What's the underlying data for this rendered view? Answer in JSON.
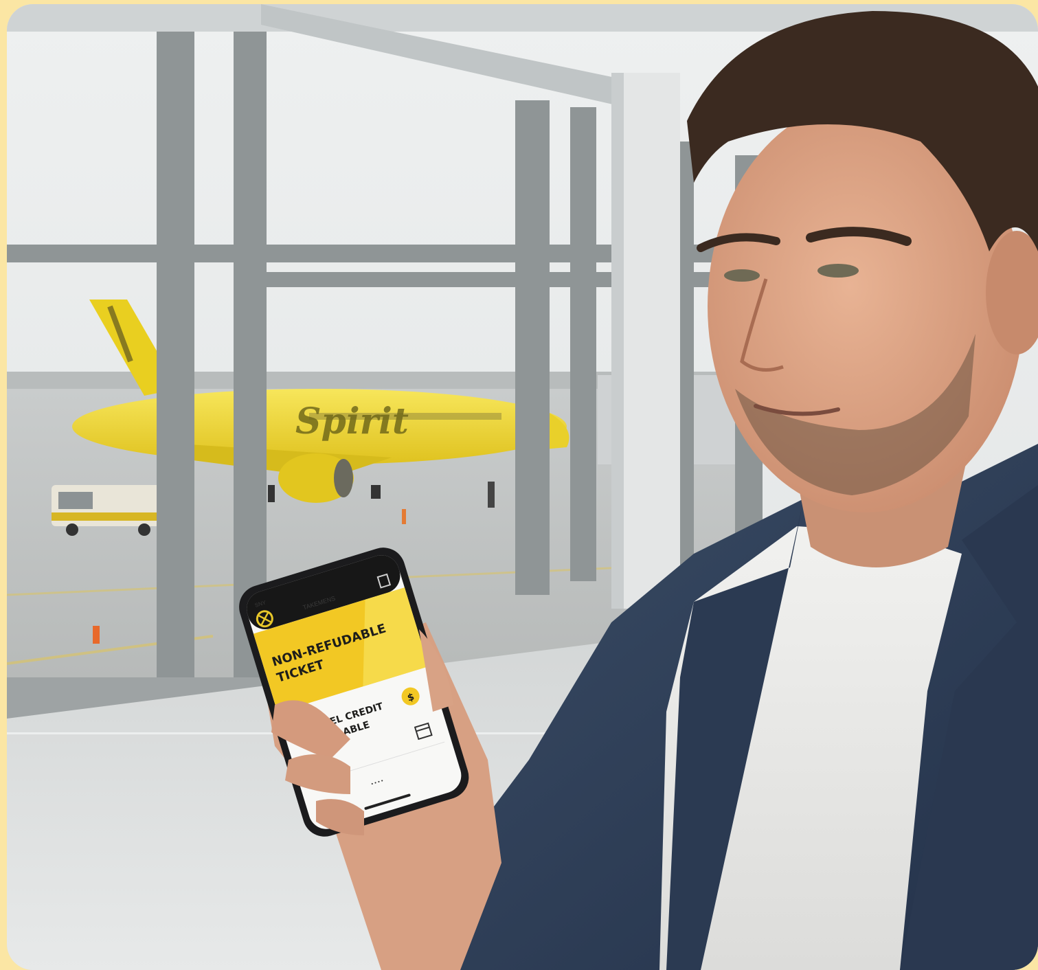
{
  "airplane": {
    "livery_text": "Spirit"
  },
  "phone": {
    "status_carrier": "SNY",
    "header_title": "TAKEMENS",
    "banner_line1": "NON-REFUDABLE",
    "banner_line2": "TICKET",
    "credit_line1": "TBAVEL CREDIT",
    "credit_line2": "AVAILABLE",
    "credit_badge": "$",
    "footer_dots": "• • • •"
  },
  "colors": {
    "frame_border": "#fbe6a4",
    "spirit_yellow": "#f0d22c",
    "jacket": "#2f3f55"
  }
}
